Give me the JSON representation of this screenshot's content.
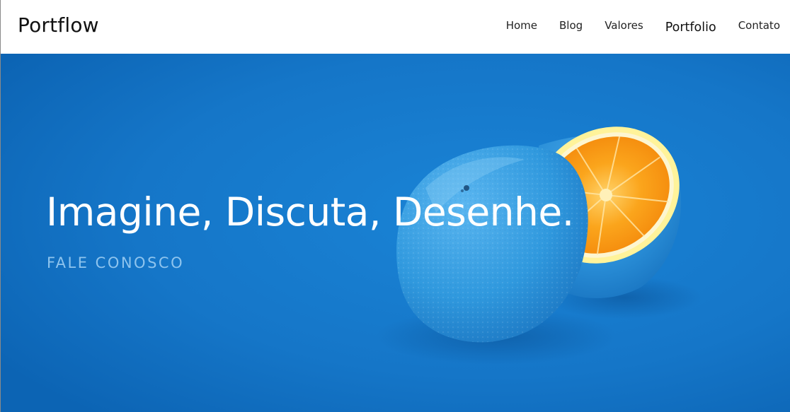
{
  "header": {
    "logo": "Portflow",
    "nav": [
      {
        "label": "Home"
      },
      {
        "label": "Blog"
      },
      {
        "label": "Valores"
      },
      {
        "label": "Portfolio",
        "active": true
      },
      {
        "label": "Contato"
      }
    ]
  },
  "hero": {
    "title": "Imagine, Discuta, Desenhe.",
    "cta": "FALE CONOSCO",
    "background_color": "#1577c9",
    "image": "blue-painted-orange-half"
  },
  "colors": {
    "accent_blue": "#1577c9",
    "orange": "#f99a12",
    "cta_text": "#8ec4ee"
  }
}
